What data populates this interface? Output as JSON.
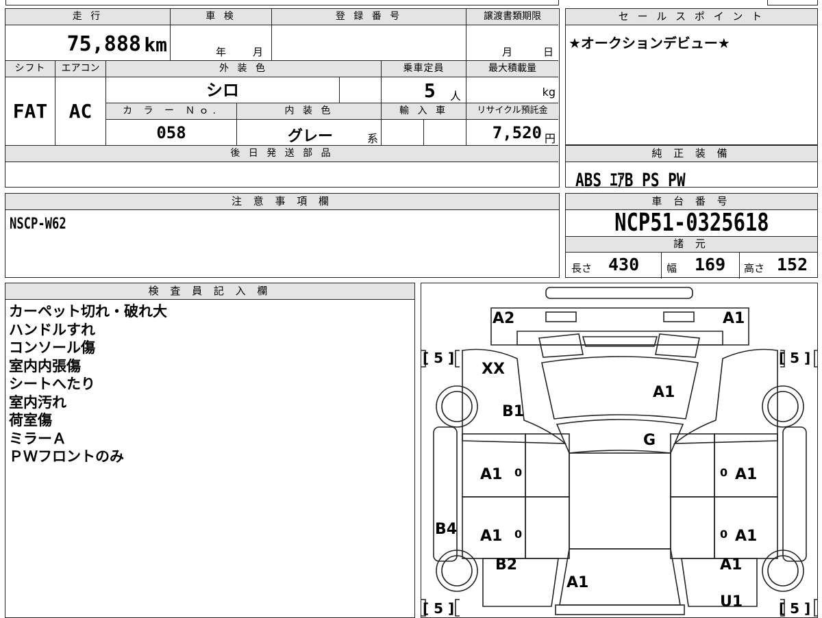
{
  "mileage": {
    "label": "走 行",
    "value": "75,888",
    "unit": "km"
  },
  "inspection": {
    "label": "車 検",
    "year_unit": "年",
    "month_unit": "月"
  },
  "registration": {
    "label": "登 録 番 号",
    "value": ""
  },
  "transfer_deadline": {
    "label": "譲渡書類期限",
    "month_unit": "月",
    "day_unit": "日"
  },
  "sales_point": {
    "label": "セ ー ル ス ポ イ ン ト",
    "text": "★オークションデビュー★"
  },
  "shift": {
    "label": "シフト",
    "value": "FAT"
  },
  "aircon": {
    "label": "エアコン",
    "value": "AC"
  },
  "exterior_color": {
    "label": "外 装 色",
    "value": "シロ"
  },
  "capacity": {
    "label": "乗車定員",
    "value": "5",
    "unit": "人"
  },
  "max_load": {
    "label": "最大積載量",
    "value": "",
    "unit": "kg"
  },
  "color_no": {
    "label": "カ ラ ー Ｎｏ.",
    "value": "058"
  },
  "interior_color": {
    "label": "内 装 色",
    "value": "グレー",
    "suffix": "系"
  },
  "import": {
    "label": "輸 入 車",
    "value": ""
  },
  "recycle_fee": {
    "label": "リサイクル預託金",
    "value": "7,520",
    "unit": "円"
  },
  "later_parts": {
    "label": "後 日 発 送 部 品",
    "value": ""
  },
  "genuine_equipment": {
    "label": "純 正 装 備",
    "value": "ABS ｴｱB PS PW"
  },
  "notes": {
    "label": "注 意 事 項 欄",
    "value": "NSCP-W62"
  },
  "chassis_number": {
    "label": "車 台 番 号",
    "value": "NCP51-0325618"
  },
  "specs": {
    "label": "諸 元",
    "length_label": "長さ",
    "length": "430",
    "width_label": "幅",
    "width": "169",
    "height_label": "高さ",
    "height": "152"
  },
  "inspector": {
    "label": "検 査 員 記 入 欄",
    "lines": [
      "カーペット切れ・破れ大",
      "ハンドルすれ",
      "コンソール傷",
      "室内内張傷",
      "シートへたり",
      "室内汚れ",
      "荷室傷",
      "ミラーＡ",
      "ＰＷフロントのみ"
    ]
  },
  "damage_map": {
    "marks": {
      "front_left": "A2",
      "front_right": "A1",
      "fender_left": "XX",
      "hood": "A1",
      "pillar_left": "B1",
      "windshield": "G",
      "front_door_left": "A1",
      "front_door_right": "A1",
      "rear_door_left": "A1",
      "rear_door_right": "A1",
      "rocker_left": "B4",
      "rear_fender_left": "B2",
      "rear_fender_right": "A1",
      "rear": "A1",
      "rear_right_bottom": "U1"
    },
    "door_small": "0",
    "tires": {
      "front_left": "[ 5 ]",
      "front_right": "[ 5 ]",
      "rear_left": "[ 5 ]",
      "rear_right": "[ 5 ]"
    }
  }
}
